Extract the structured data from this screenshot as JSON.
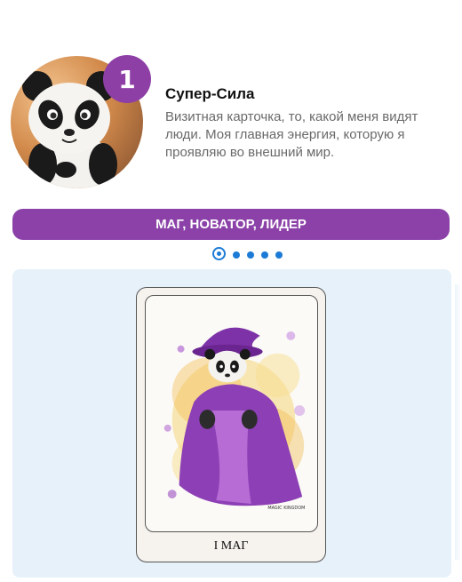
{
  "header": {
    "badge_number": "1",
    "title": "Супер-Сила",
    "description": "Визитная карточка, то, какой меня видят люди. Моя главная энергия, которую я проявляю во внешний мир."
  },
  "avatar": {
    "icon": "panda-avatar"
  },
  "traits_banner": "МАГ, НОВАТОР, ЛИДЕР",
  "carousel": {
    "dot_count": 5,
    "active_index": 0
  },
  "tarot_card": {
    "label": "I МАГ",
    "image": "panda-wizard-illustration",
    "artist_signature": "MAGIC KINGDOM"
  },
  "colors": {
    "accent_purple": "#8b41a8",
    "dot_blue": "#1c7bd6",
    "panel_bg": "#e7f1f9"
  }
}
